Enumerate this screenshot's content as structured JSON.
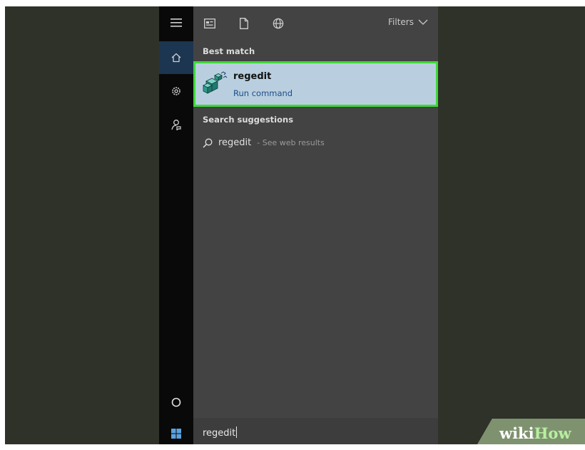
{
  "toolbar": {
    "icons": [
      "apps-icon",
      "document-icon",
      "web-icon"
    ],
    "filters_label": "Filters"
  },
  "sidebar": {
    "items": [
      "menu-icon",
      "home-icon",
      "settings-icon",
      "feedback-icon",
      "cortana-icon",
      "windows-start-icon"
    ]
  },
  "results": {
    "best_match_label": "Best match",
    "best_match": {
      "title": "regedit",
      "subtitle": "Run command",
      "icon": "regedit-icon"
    },
    "suggestions_label": "Search suggestions",
    "suggestion": {
      "query": "regedit",
      "hint": "- See web results",
      "icon": "search-icon"
    }
  },
  "search": {
    "value": "regedit"
  },
  "watermark": {
    "part1": "wiki",
    "part2": "How"
  },
  "colors": {
    "desktop": "#2e3228",
    "panel": "#434343",
    "rail": "#090909",
    "highlight": "#b9cfe0",
    "highlight_border": "#3fd83a",
    "link": "#1d4d87"
  }
}
